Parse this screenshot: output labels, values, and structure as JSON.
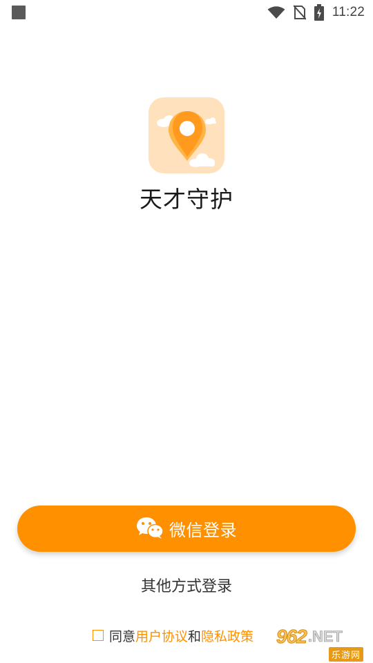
{
  "status_bar": {
    "time": "11:22",
    "icons": [
      "notification-square-icon",
      "wifi-icon",
      "no-sim-icon",
      "battery-charging-icon"
    ]
  },
  "app": {
    "name": "天才守护",
    "logo_icon": "location-pin-with-clouds-icon"
  },
  "login": {
    "wechat_label": "微信登录",
    "wechat_icon": "wechat-icon",
    "other_label": "其他方式登录"
  },
  "agreement": {
    "prefix": "同意",
    "user_agreement": "用户协议",
    "and": "和",
    "privacy_policy": "隐私政策",
    "checked": false
  },
  "watermark": {
    "number": "962",
    "suffix": ".NET",
    "sub": "乐游网"
  },
  "colors": {
    "accent": "#ff9100",
    "logo_bg": "#ffe2bd",
    "text": "#333333"
  }
}
